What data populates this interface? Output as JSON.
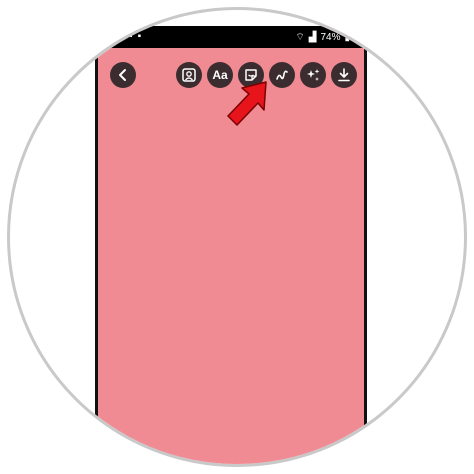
{
  "statusbar": {
    "battery_percent": "74%"
  },
  "toolbar": {
    "text_button_label": "Aa",
    "icons": [
      "back-chevron-icon",
      "mention-person-icon",
      "text-icon",
      "sticker-icon",
      "draw-scribble-icon",
      "effects-sparkle-icon",
      "download-icon"
    ]
  },
  "colors": {
    "canvas": "#f08a93",
    "button": "#3b2d2f",
    "arrow": "#e8141c"
  }
}
